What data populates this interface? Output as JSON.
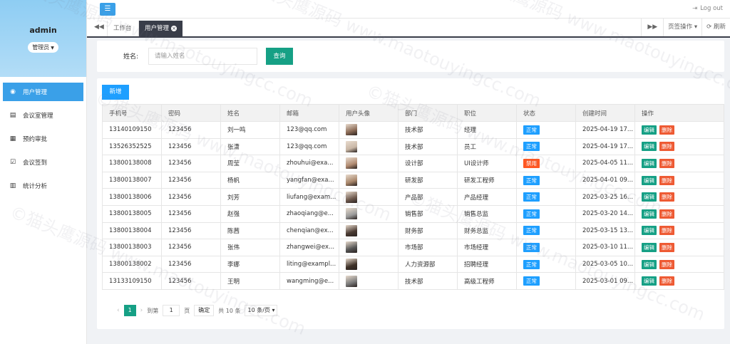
{
  "sidebar": {
    "username": "admin",
    "role": "管理员",
    "items": [
      {
        "label": "用户管理",
        "icon": "user-circle-icon",
        "active": true
      },
      {
        "label": "会议室管理",
        "icon": "card-icon",
        "active": false
      },
      {
        "label": "预约审批",
        "icon": "calendar-icon",
        "active": false
      },
      {
        "label": "会议签到",
        "icon": "check-square-icon",
        "active": false
      },
      {
        "label": "统计分析",
        "icon": "bar-chart-icon",
        "active": false
      }
    ]
  },
  "topbar": {
    "logout": "Log out"
  },
  "tabs": {
    "workbench": "工作台",
    "user_mgmt": "用户管理",
    "tab_ops": "页签操作",
    "refresh": "刷新"
  },
  "search": {
    "label": "姓名:",
    "placeholder": "请输入姓名",
    "button": "查询"
  },
  "table": {
    "add_button": "新增",
    "headers": [
      "手机号",
      "密码",
      "姓名",
      "邮箱",
      "用户头像",
      "部门",
      "职位",
      "状态",
      "创建时间",
      "操作"
    ],
    "rows": [
      {
        "phone": "13140109150",
        "password": "123456",
        "name": "刘一鸣",
        "email": "123@qq.com",
        "avatar_color": "#8a6a55",
        "dept": "技术部",
        "position": "经理",
        "status": "正常",
        "created": "2025-04-19 17..."
      },
      {
        "phone": "13526352525",
        "password": "123456",
        "name": "张潇",
        "email": "123@qq.com",
        "avatar_color": "#c9b7a6",
        "dept": "技术部",
        "position": "员工",
        "status": "正常",
        "created": "2025-04-19 17..."
      },
      {
        "phone": "13800138008",
        "password": "123456",
        "name": "周莹",
        "email": "zhouhui@exa...",
        "avatar_color": "#b08a70",
        "dept": "设计部",
        "position": "UI设计师",
        "status": "禁用",
        "created": "2025-04-05 11..."
      },
      {
        "phone": "13800138007",
        "password": "123456",
        "name": "杨帆",
        "email": "yangfan@exa...",
        "avatar_color": "#a8866a",
        "dept": "研发部",
        "position": "研发工程师",
        "status": "正常",
        "created": "2025-04-01 09..."
      },
      {
        "phone": "13800138006",
        "password": "123456",
        "name": "刘芳",
        "email": "liufang@exam...",
        "avatar_color": "#6f5a4e",
        "dept": "产品部",
        "position": "产品经理",
        "status": "正常",
        "created": "2025-03-25 16..."
      },
      {
        "phone": "13800138005",
        "password": "123456",
        "name": "赵强",
        "email": "zhaoqiang@e...",
        "avatar_color": "#9a9a9a",
        "dept": "销售部",
        "position": "销售总监",
        "status": "正常",
        "created": "2025-03-20 14..."
      },
      {
        "phone": "13800138004",
        "password": "123456",
        "name": "陈茜",
        "email": "chenqian@ex...",
        "avatar_color": "#4a3a32",
        "dept": "财务部",
        "position": "财务总监",
        "status": "正常",
        "created": "2025-03-15 13..."
      },
      {
        "phone": "13800138003",
        "password": "123456",
        "name": "张伟",
        "email": "zhangwei@ex...",
        "avatar_color": "#555555",
        "dept": "市场部",
        "position": "市场经理",
        "status": "正常",
        "created": "2025-03-10 11..."
      },
      {
        "phone": "13800138002",
        "password": "123456",
        "name": "李娜",
        "email": "liting@exampl...",
        "avatar_color": "#3e3128",
        "dept": "人力资源部",
        "position": "招聘经理",
        "status": "正常",
        "created": "2025-03-05 10..."
      },
      {
        "phone": "13133109150",
        "password": "123456",
        "name": "王明",
        "email": "wangming@e...",
        "avatar_color": "#7a7a7a",
        "dept": "技术部",
        "position": "高级工程师",
        "status": "正常",
        "created": "2025-03-01 09..."
      }
    ],
    "edit_label": "编辑",
    "delete_label": "删除",
    "status_colors": {
      "正常": "#1e9fff",
      "禁用": "#ff5722"
    }
  },
  "pager": {
    "current": "1",
    "goto_label": "到第",
    "page_input": "1",
    "page_unit": "页",
    "confirm": "确定",
    "total": "共 10 条",
    "page_size": "10 条/页"
  },
  "watermark": "©猫头鹰源码 www.maotouyingcc.com"
}
